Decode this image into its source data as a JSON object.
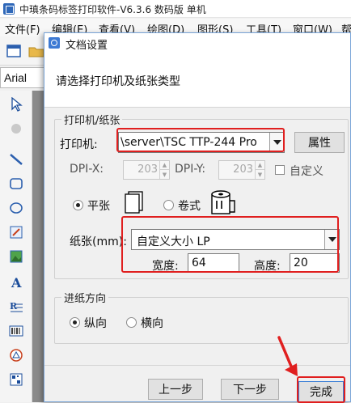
{
  "app": {
    "title": "中瑱条码标签打印软件-V6.3.6 数码版 单机",
    "menu": [
      "文件(F)",
      "编辑(E)",
      "查看(V)",
      "绘图(D)",
      "图形(S)",
      "工具(T)",
      "窗口(W)",
      "帮"
    ],
    "font_name": "Arial"
  },
  "dialog": {
    "title": "文档设置",
    "instruction": "请选择打印机及纸张类型",
    "printer_group": {
      "legend": "打印机/纸张",
      "printer_label": "打印机:",
      "printer_value": "\\server\\TSC TTP-244 Pro",
      "properties_button": "属性",
      "dpi_x_label": "DPI-X:",
      "dpi_x_value": "203",
      "dpi_y_label": "DPI-Y:",
      "dpi_y_value": "203",
      "custom_label": "自定义",
      "sheet_label": "平张",
      "roll_label": "卷式",
      "paper_type": "sheet",
      "paper_label": "纸张(mm):",
      "paper_value": "自定义大小 LP",
      "width_label": "宽度:",
      "width_value": "64",
      "height_label": "高度:",
      "height_value": "20"
    },
    "feed_group": {
      "legend": "进纸方向",
      "portrait_label": "纵向",
      "landscape_label": "横向",
      "orientation": "portrait"
    },
    "buttons": {
      "prev": "上一步",
      "next": "下一步",
      "finish": "完成"
    }
  },
  "colors": {
    "highlight": "#e01f1f",
    "accent": "#3d7ad4"
  }
}
